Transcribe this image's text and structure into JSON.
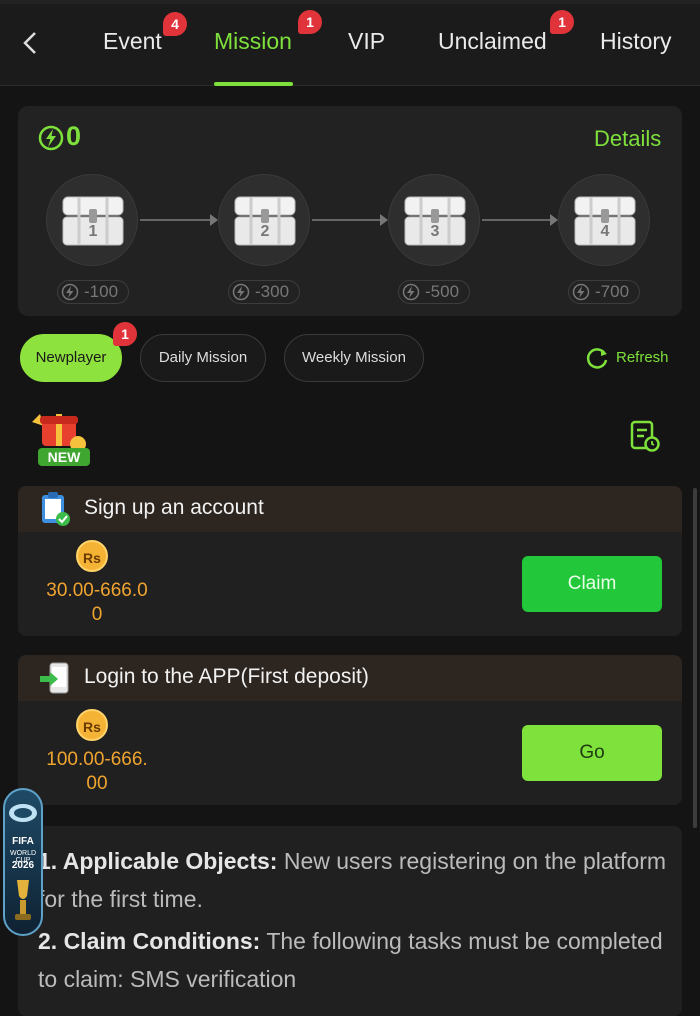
{
  "header": {
    "tabs": [
      {
        "label": "Event",
        "badge": "4"
      },
      {
        "label": "Mission",
        "badge": "1",
        "active": true
      },
      {
        "label": "VIP",
        "badge": ""
      },
      {
        "label": "Unclaimed",
        "badge": "1"
      },
      {
        "label": "History",
        "badge": ""
      }
    ]
  },
  "energy": {
    "value": "0",
    "details_label": "Details"
  },
  "chests": [
    {
      "number": "1",
      "cost": "-100"
    },
    {
      "number": "2",
      "cost": "-300"
    },
    {
      "number": "3",
      "cost": "-500"
    },
    {
      "number": "4",
      "cost": "-700"
    }
  ],
  "filters": {
    "items": [
      {
        "label": "Newplayer",
        "badge": "1",
        "active": true
      },
      {
        "label": "Daily Mission"
      },
      {
        "label": "Weekly Mission"
      }
    ],
    "refresh_label": "Refresh"
  },
  "new_label": "NEW",
  "tasks": [
    {
      "title": "Sign up an account",
      "currency": "Rs",
      "amount_line1": "30.00-666.0",
      "amount_line2": "0",
      "button": "Claim"
    },
    {
      "title": "Login to the APP(First deposit)",
      "currency": "Rs",
      "amount_line1": "100.00-666.",
      "amount_line2": "00",
      "button": "Go"
    }
  ],
  "rules": {
    "item1_title": "1. Applicable Objects:",
    "item1_text": " New users registering on the platform for the first time.",
    "item2_title": "2. Claim Conditions:",
    "item2_text": " The following tasks must be completed to claim: SMS verification"
  },
  "floating_banner": {
    "line1": "FIFA",
    "line2": "WORLD CUP",
    "line3": "2026"
  },
  "colors": {
    "accent": "#7ee03a",
    "badge": "#e0343a",
    "amount": "#f0a430",
    "claim_button": "#22c83a",
    "go_button": "#7fe23c"
  }
}
